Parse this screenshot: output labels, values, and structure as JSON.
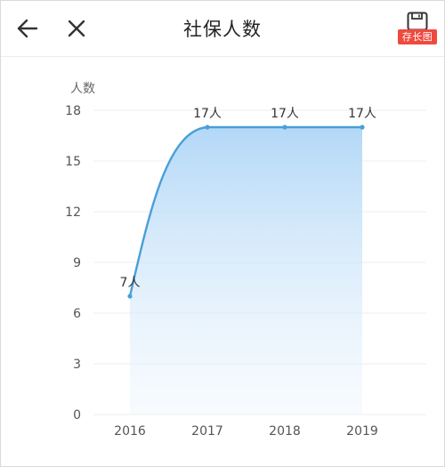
{
  "header": {
    "title": "社保人数",
    "back_icon": "arrow-left-icon",
    "close_icon": "close-icon",
    "save_icon": "floppy-disk-icon",
    "save_label": "存长图",
    "save_badge_color": "#f0493e"
  },
  "chart_data": {
    "type": "area",
    "title": "",
    "xlabel": "",
    "ylabel": "人数",
    "categories": [
      "2016",
      "2017",
      "2018",
      "2019"
    ],
    "series": [
      {
        "values": [
          7,
          17,
          17,
          17
        ],
        "labels": [
          "7人",
          "17人",
          "17人",
          "17人"
        ]
      }
    ],
    "ylim": [
      0,
      18
    ],
    "yticks": [
      0,
      3,
      6,
      9,
      12,
      15,
      18
    ],
    "grid": true,
    "line_color": "#4a9fd8",
    "fill_color": "#b9dcf8"
  }
}
